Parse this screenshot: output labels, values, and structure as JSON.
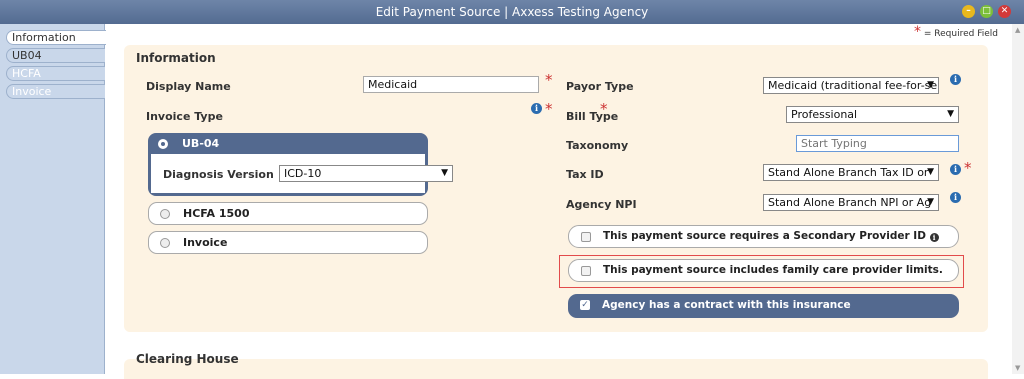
{
  "window": {
    "title": "Edit Payment Source | Axxess Testing Agency"
  },
  "sidebar": {
    "tabs": [
      {
        "label": "Information"
      },
      {
        "label": "UB04"
      },
      {
        "label": "HCFA"
      },
      {
        "label": "Invoice"
      }
    ]
  },
  "required_note": {
    "star": "*",
    "text": "= Required Field"
  },
  "information": {
    "title": "Information",
    "display_name": {
      "label": "Display Name",
      "value": "Medicaid"
    },
    "invoice_type": {
      "label": "Invoice Type",
      "options": [
        {
          "label": "UB-04",
          "selected": true
        },
        {
          "label": "HCFA 1500",
          "selected": false
        },
        {
          "label": "Invoice",
          "selected": false
        }
      ],
      "diagnosis_version": {
        "label": "Diagnosis Version",
        "value": "ICD-10"
      }
    },
    "payor_type": {
      "label": "Payor Type",
      "value": "Medicaid (traditional fee-for-se"
    },
    "bill_type": {
      "label": "Bill Type",
      "value": "Professional"
    },
    "taxonomy": {
      "label": "Taxonomy",
      "placeholder": "Start Typing"
    },
    "tax_id": {
      "label": "Tax ID",
      "value": "Stand Alone Branch Tax ID or"
    },
    "agency_npi": {
      "label": "Agency NPI",
      "value": "Stand Alone Branch NPI or Ag"
    },
    "checkboxes": [
      {
        "label": "This payment source requires a Secondary Provider ID",
        "checked": false
      },
      {
        "label": "This payment source includes family care provider limits.",
        "checked": false
      },
      {
        "label": "Agency has a contract with this insurance",
        "checked": true
      }
    ]
  },
  "clearing_house": {
    "title": "Clearing House"
  },
  "colors": {
    "accent": "#53698f",
    "panel": "#fdf3e3",
    "required": "#cc3333",
    "highlight": "#e24b4b"
  }
}
